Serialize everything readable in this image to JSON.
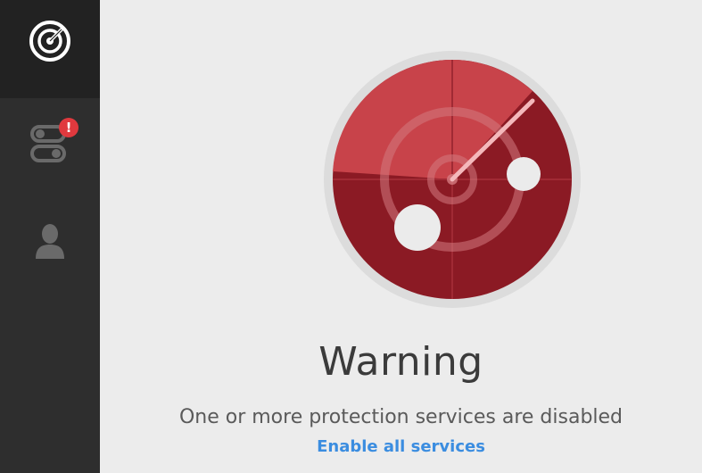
{
  "sidebar": {
    "logo_icon": "radar-logo-icon",
    "items": [
      {
        "icon": "toggle-switches-icon",
        "badge": "!"
      },
      {
        "icon": "user-silhouette-icon"
      }
    ]
  },
  "status": {
    "title": "Warning",
    "message": "One or more protection services are disabled",
    "action_label": "Enable all services"
  },
  "colors": {
    "sidebar_bg": "#2e2e2e",
    "sidebar_top_bg": "#222222",
    "badge": "#e0393e",
    "radar_dark": "#8b1a24",
    "radar_light": "#c8434a",
    "link": "#3b8de0",
    "page_bg": "#ececec"
  }
}
